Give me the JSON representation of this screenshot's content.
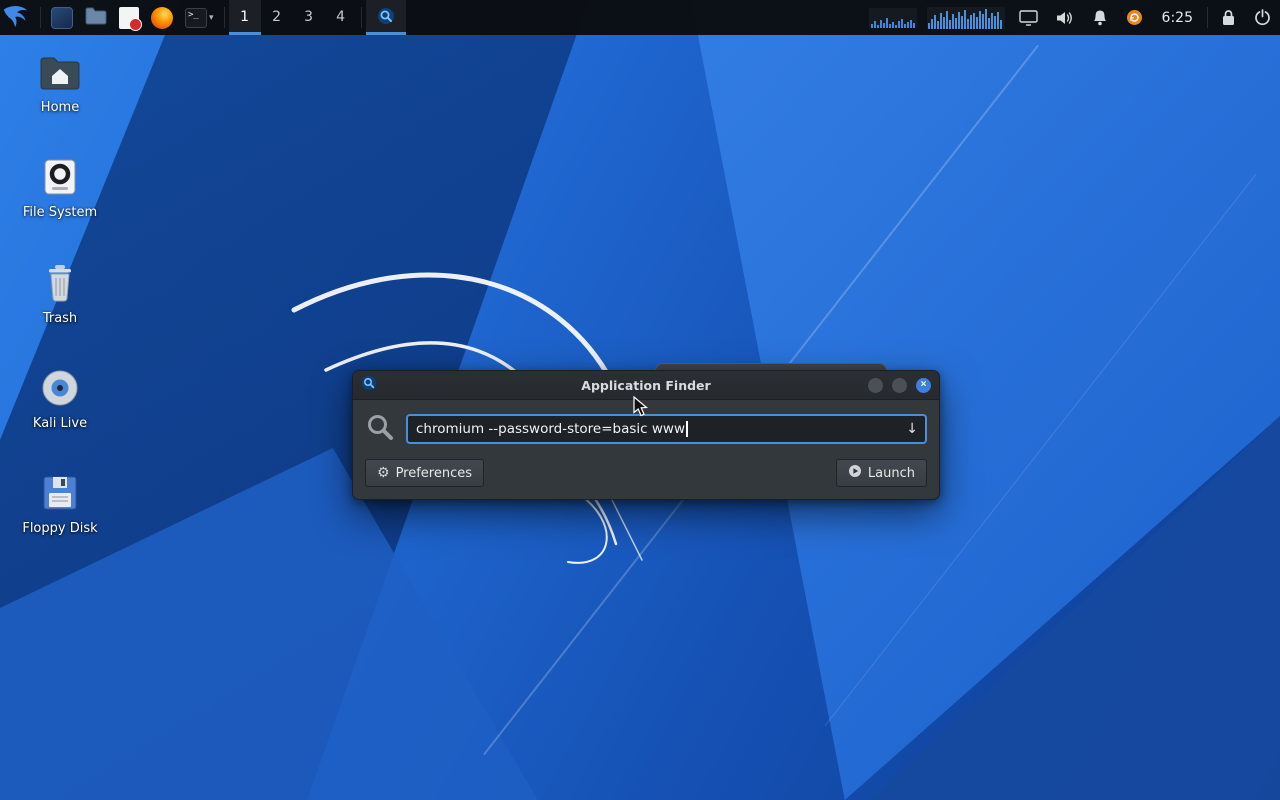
{
  "colors": {
    "accent": "#4a90d9",
    "panel_bg": "#0b0e12",
    "window_bg": "#33383d",
    "titlebar_bg": "#26292e",
    "close_button": "#3d7fe0",
    "wallpaper_base": "#1d5fc6"
  },
  "panel": {
    "workspaces": [
      {
        "label": "1",
        "active": true
      },
      {
        "label": "2",
        "active": false
      },
      {
        "label": "3",
        "active": false
      },
      {
        "label": "4",
        "active": false
      }
    ],
    "terminal_glyph": ">_",
    "chevron_glyph": "▾",
    "clock": "6:25"
  },
  "desktop": {
    "icons": [
      {
        "label": "Home"
      },
      {
        "label": "File System"
      },
      {
        "label": "Trash"
      },
      {
        "label": "Kali Live"
      },
      {
        "label": "Floppy Disk"
      }
    ]
  },
  "finder": {
    "title": "Application Finder",
    "search": {
      "value": "chromium --password-store=basic www"
    },
    "dropdown_arrow": "↓",
    "preferences_label": "Preferences",
    "launch_label": "Launch",
    "gear_glyph": "⚙",
    "close_glyph": "×"
  }
}
